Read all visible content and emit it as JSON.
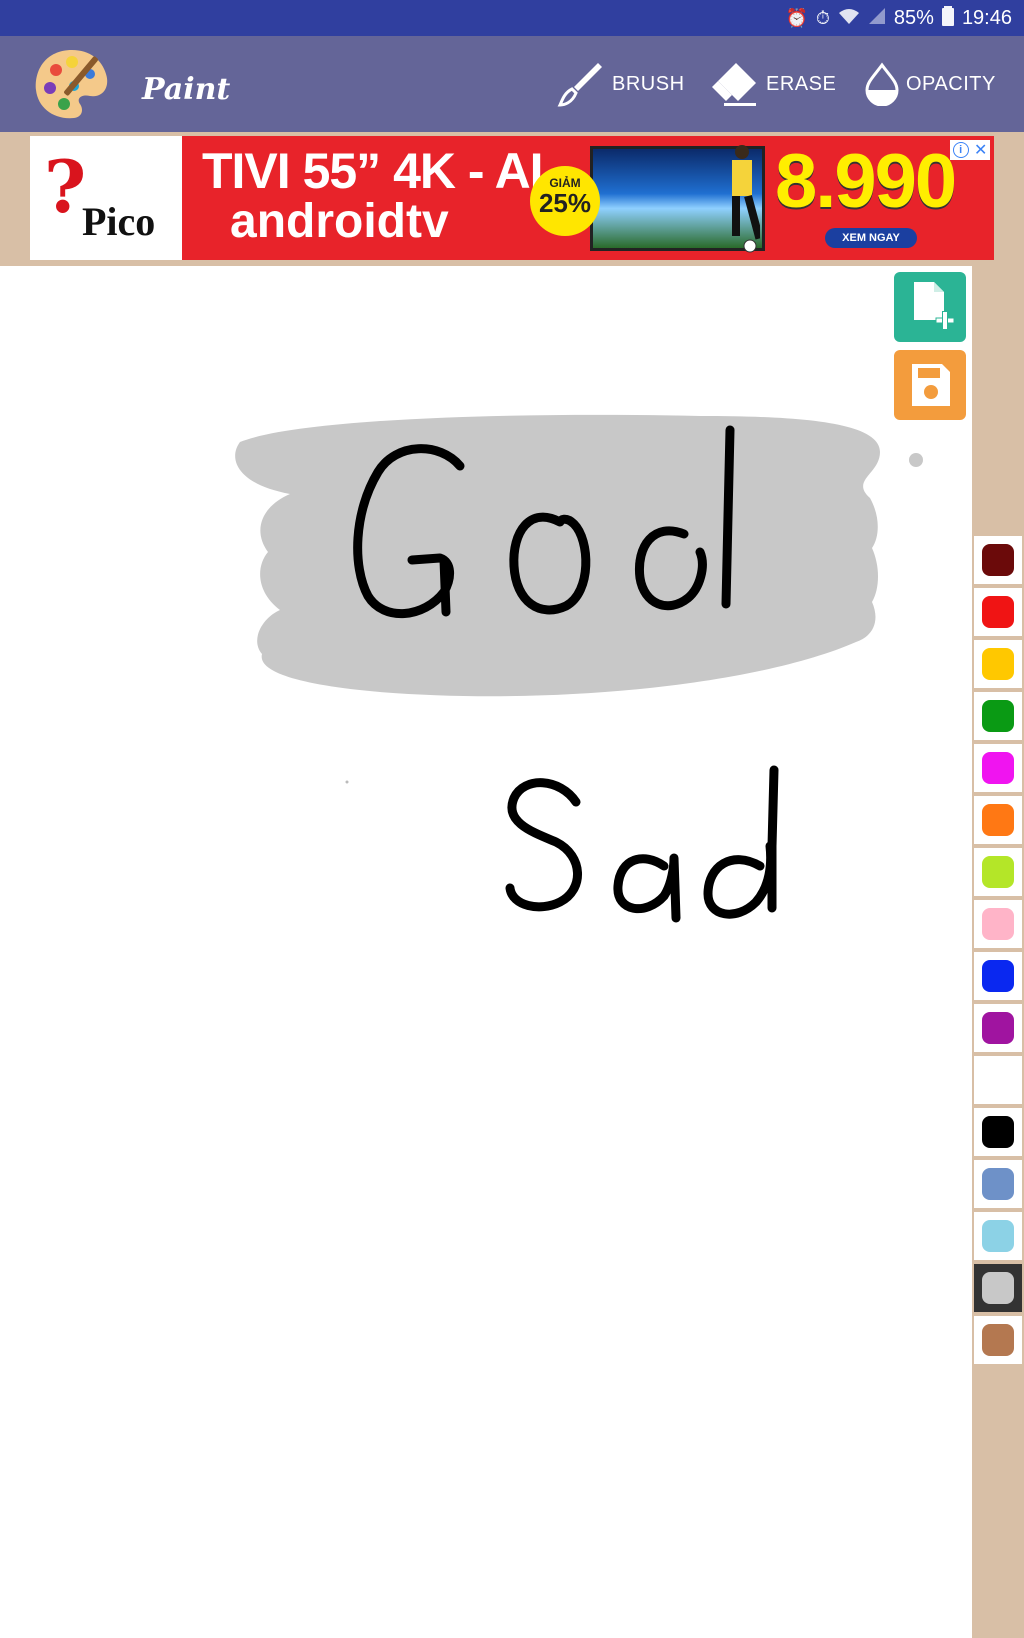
{
  "status_bar": {
    "battery": "85%",
    "time": "19:46",
    "icons": [
      "alarm-lock-icon",
      "alarm-clock-icon",
      "wifi-icon",
      "signal-icon",
      "battery-icon"
    ]
  },
  "app_bar": {
    "app_name": "Paint",
    "tools": [
      {
        "label": "BRUSH",
        "icon": "brush-icon"
      },
      {
        "label": "ERASE",
        "icon": "eraser-icon"
      },
      {
        "label": "OPACITY",
        "icon": "opacity-drop-icon"
      }
    ]
  },
  "ad": {
    "brand": "Pico",
    "headline": "TIVI 55” 4K - AI",
    "subline": "androidtv",
    "badge_small": "GIẢM",
    "badge_big": "25%",
    "price": "8.990",
    "cta": "XEM NGAY"
  },
  "canvas": {
    "texts": [
      "God",
      "Sad"
    ],
    "highlight_color": "#c8c8c8",
    "ink_color": "#000000"
  },
  "side_buttons": {
    "new_icon": "new-file-icon",
    "save_icon": "save-icon",
    "new_color": "#2bb495",
    "save_color": "#f39c3d"
  },
  "palette": {
    "selected_index": 14,
    "colors": [
      "#6b0a0a",
      "#f01414",
      "#ffc800",
      "#0a9a14",
      "#f014f0",
      "#ff7814",
      "#b4e628",
      "#ffb4c8",
      "#0a28f0",
      "#a014a0",
      "#ffffff",
      "#000000",
      "#6e91c8",
      "#8cd2e6",
      "#c8c8c8",
      "#b47850"
    ]
  }
}
